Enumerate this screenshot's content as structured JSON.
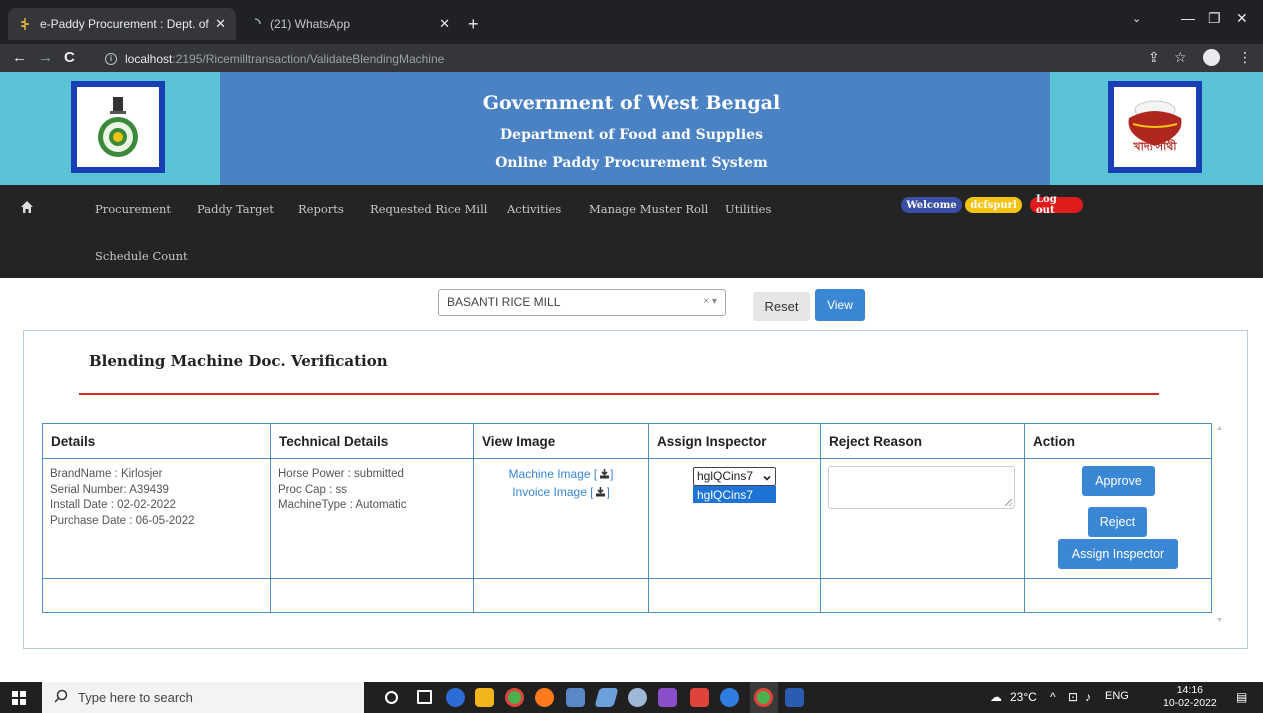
{
  "browser": {
    "tabs": [
      {
        "title": "e-Paddy Procurement : Dept. of F",
        "active": true
      },
      {
        "title": "(21) WhatsApp",
        "active": false
      }
    ],
    "url_host": "localhost",
    "url_path": ":2195/Ricemilltransaction/ValidateBlendingMachine"
  },
  "header": {
    "title": "Government of West Bengal",
    "subtitle1": "Department of Food and Supplies",
    "subtitle2": "Online Paddy Procurement System",
    "right_logo_text": "খাদ্য সাথী"
  },
  "nav": {
    "items": [
      "Procurement",
      "Paddy Target",
      "Reports",
      "Requested Rice Mill",
      "Activities",
      "Manage Muster Roll",
      "Utilities",
      "Schedule Count"
    ],
    "welcome": "Welcome",
    "user": "dcfspurl",
    "logout": "Log out"
  },
  "filter": {
    "selected_mill": "BASANTI RICE MILL",
    "reset_label": "Reset",
    "view_label": "View"
  },
  "panel": {
    "title": "Blending Machine Doc. Verification"
  },
  "table": {
    "headers": [
      "Details",
      "Technical Details",
      "View Image",
      "Assign Inspector",
      "Reject Reason",
      "Action"
    ],
    "row": {
      "details": [
        "BrandName : Kirlosjer",
        "Serial Number: A39439",
        "Install Date : 02-02-2022",
        "Purchase Date : 06-05-2022"
      ],
      "technical": [
        "Horse Power : submitted",
        "Proc Cap : ss",
        "MachineType : Automatic"
      ],
      "machine_image": "Machine Image",
      "invoice_image": "Invoice Image",
      "inspector_selected": "hglQCins7",
      "inspector_option": "hglQCins7",
      "reject_reason": ""
    },
    "actions": {
      "approve": "Approve",
      "reject": "Reject",
      "assign": "Assign Inspector"
    }
  },
  "taskbar": {
    "search_placeholder": "Type here to search",
    "temperature": "23°C",
    "language": "ENG",
    "time": "14:16",
    "date": "10-02-2022"
  },
  "colors": {
    "banner_blue": "#4a82c4",
    "banner_cyan": "#5ac4d6",
    "nav_dark": "#242424",
    "primary_button": "#3a87d6",
    "divider_red": "#d62b2b",
    "welcome_pill": "#3a4fa3",
    "user_pill": "#f2c311",
    "logout_pill": "#e01b1b"
  }
}
